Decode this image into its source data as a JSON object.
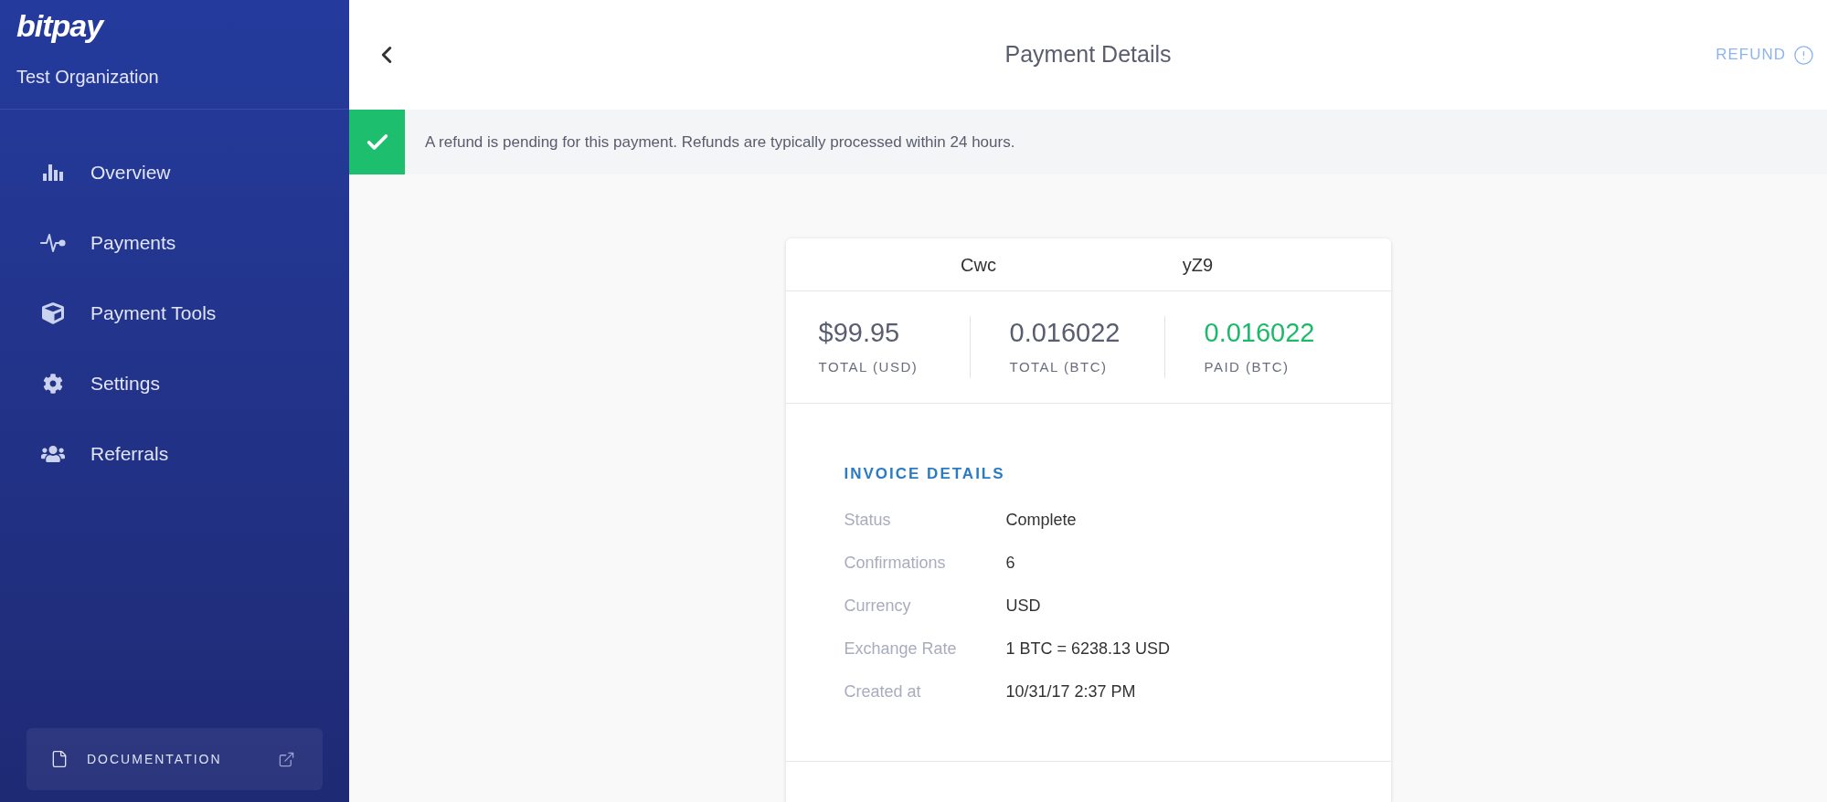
{
  "sidebar": {
    "logo": "bitpay",
    "organization": "Test Organization",
    "nav_items": [
      "Overview",
      "Payments",
      "Payment Tools",
      "Settings",
      "Referrals"
    ],
    "documentation_link": "DOCUMENTATION"
  },
  "header": {
    "title": "Payment Details",
    "refund_button": "REFUND"
  },
  "notice": {
    "text": "A refund is pending for this payment. Refunds are typically processed within 24 hours."
  },
  "payment_card": {
    "header_cells": [
      "Cwc",
      "yZ9"
    ],
    "totals": [
      {
        "value": "$99.95",
        "label": "TOTAL (USD)",
        "color": "#595d70"
      },
      {
        "value": "0.016022",
        "label": "TOTAL (BTC)",
        "color": "#595d70"
      },
      {
        "value": "0.016022",
        "label": "PAID (BTC)",
        "color": "#1dba6b"
      }
    ],
    "invoice_details": {
      "title": "INVOICE DETAILS",
      "rows": [
        {
          "label": "Status",
          "value": "Complete"
        },
        {
          "label": "Confirmations",
          "value": "6"
        },
        {
          "label": "Currency",
          "value": "USD"
        },
        {
          "label": "Exchange Rate",
          "value": "1 BTC = 6238.13 USD"
        },
        {
          "label": "Created at",
          "value": "10/31/17 2:37 PM"
        }
      ]
    }
  }
}
